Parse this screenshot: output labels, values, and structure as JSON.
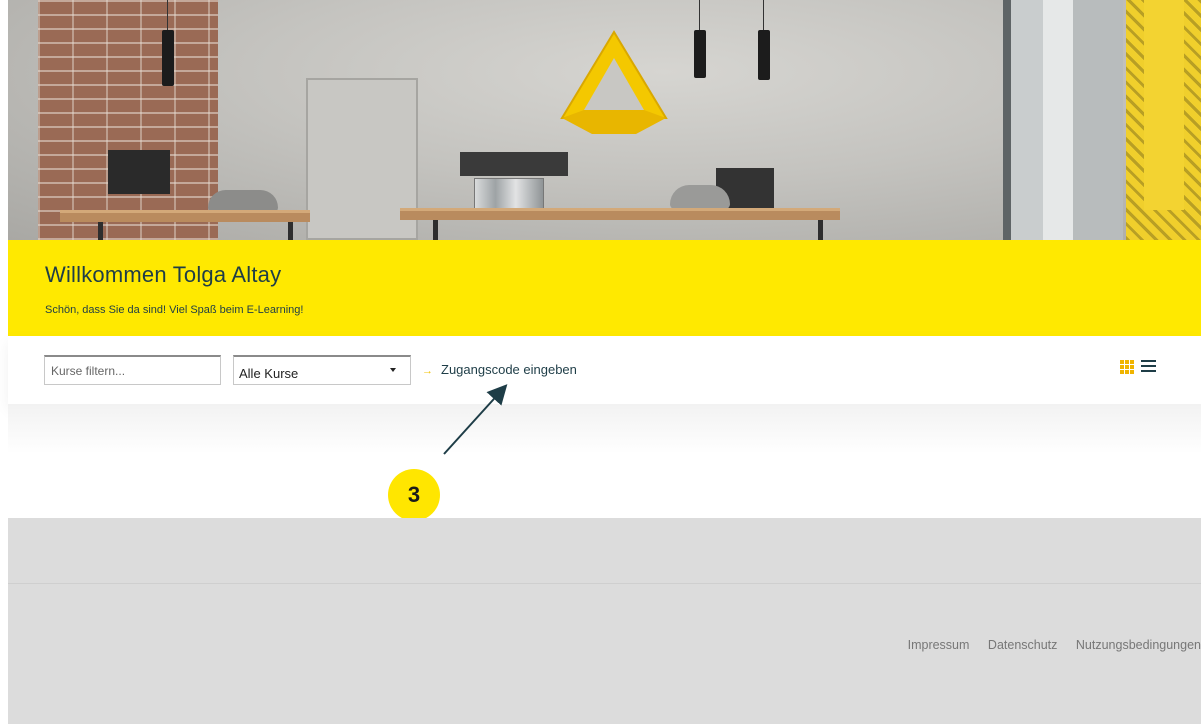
{
  "welcome": {
    "title": "Willkommen Tolga Altay",
    "subtitle": "Schön, dass Sie da sind! Viel Spaß beim E-Learning!"
  },
  "filter": {
    "placeholder": "Kurse filtern...",
    "course_select_value": "Alle Kurse",
    "access_code_label": "Zugangscode eingeben",
    "access_code_arrow": "→"
  },
  "view_toggle": {
    "grid_icon": "grid-icon",
    "list_icon": "list-icon"
  },
  "annotation": {
    "badge_number": "3"
  },
  "footer": {
    "links": [
      "Impressum",
      "Datenschutz",
      "Nutzungsbedingungen"
    ]
  },
  "colors": {
    "brand_yellow": "#ffe900",
    "text_dark": "#1e3d47",
    "footer_bg": "#dcdcdc"
  }
}
